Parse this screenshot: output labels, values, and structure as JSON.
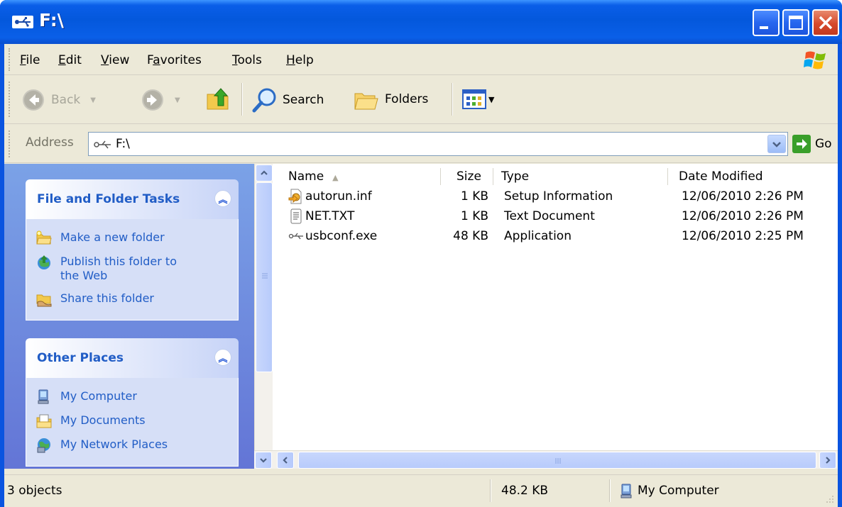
{
  "window": {
    "title": "F:\\"
  },
  "menu": [
    {
      "label": "File",
      "underline": "F",
      "rest": "ile"
    },
    {
      "label": "Edit",
      "underline": "E",
      "rest": "dit"
    },
    {
      "label": "View",
      "underline": "V",
      "rest": "iew"
    },
    {
      "label": "Favorites",
      "pre": "F",
      "underline": "a",
      "rest": "vorites"
    },
    {
      "label": "Tools",
      "underline": "T",
      "rest": "ools"
    },
    {
      "label": "Help",
      "underline": "H",
      "rest": "elp"
    }
  ],
  "toolbar": {
    "back_label": "Back",
    "search_label": "Search",
    "folders_label": "Folders"
  },
  "address": {
    "label": "Address",
    "value": "F:\\",
    "go_label": "Go"
  },
  "tasks": {
    "file_folder": {
      "title": "File and Folder Tasks",
      "items": [
        {
          "label": "Make a new folder",
          "icon": "new-folder-icon"
        },
        {
          "label": "Publish this folder to the Web",
          "line1": "Publish this folder to",
          "line2": "the Web",
          "icon": "publish-web-icon"
        },
        {
          "label": "Share this folder",
          "icon": "share-folder-icon"
        }
      ]
    },
    "other_places": {
      "title": "Other Places",
      "items": [
        {
          "label": "My Computer",
          "icon": "my-computer-icon"
        },
        {
          "label": "My Documents",
          "icon": "my-documents-icon"
        },
        {
          "label": "My Network Places",
          "icon": "network-places-icon"
        }
      ]
    }
  },
  "columns": {
    "name": "Name",
    "size": "Size",
    "type": "Type",
    "date": "Date Modified"
  },
  "files": [
    {
      "name": "autorun.inf",
      "size": "1 KB",
      "type": "Setup Information",
      "date": "12/06/2010 2:26 PM",
      "icon": "setup-info-icon"
    },
    {
      "name": "NET.TXT",
      "size": "1 KB",
      "type": "Text Document",
      "date": "12/06/2010 2:26 PM",
      "icon": "text-document-icon"
    },
    {
      "name": "usbconf.exe",
      "size": "48 KB",
      "type": "Application",
      "date": "12/06/2010 2:25 PM",
      "icon": "usb-application-icon"
    }
  ],
  "status": {
    "objects": "3 objects",
    "size": "48.2 KB",
    "location": "My Computer"
  },
  "colors": {
    "titlebar": "#0a5ee8",
    "taskpane": "#6f8fe0",
    "task_link": "#215dc6",
    "chrome": "#ece9d8"
  }
}
